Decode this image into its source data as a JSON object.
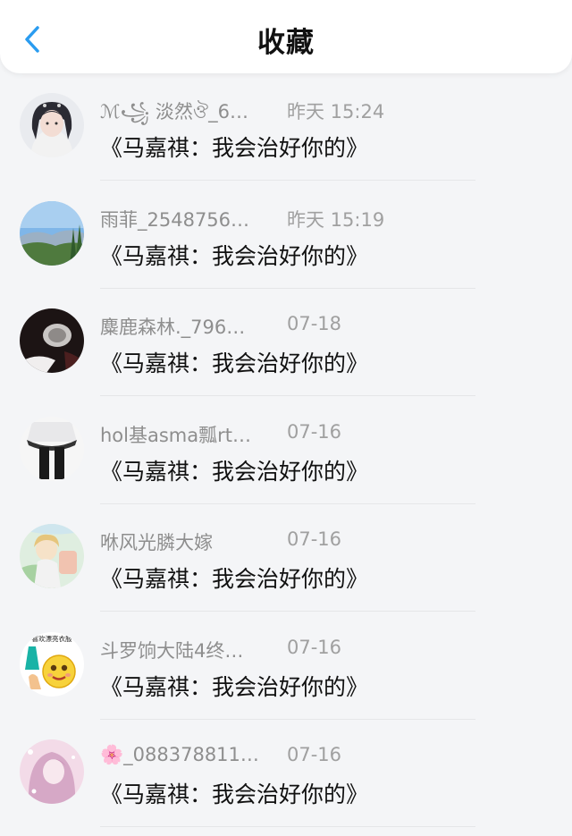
{
  "header": {
    "title": "收藏",
    "back_icon": "chevron-left-icon",
    "accent": "#2a9cf0"
  },
  "items": [
    {
      "name": "ℳ꧁ 淡然ঔ_6…",
      "time": "昨天 15:24",
      "message": "《马嘉祺：我会治好你的》",
      "avatar": "anime-girl-avatar"
    },
    {
      "name": "雨菲_2548756…",
      "time": "昨天 15:19",
      "message": "《马嘉祺：我会治好你的》",
      "avatar": "landscape-avatar"
    },
    {
      "name": "麋鹿森林._796…",
      "time": "07-18",
      "message": "《马嘉祺：我会治好你的》",
      "avatar": "dark-photo-avatar"
    },
    {
      "name": "hol基asma瓢rt…",
      "time": "07-16",
      "message": "《马嘉祺：我会治好你的》",
      "avatar": "skirt-legs-avatar"
    },
    {
      "name": "咻风光膦大嫁",
      "time": "07-16",
      "message": "《马嘉祺：我会治好你的》",
      "avatar": "anime-boy-avatar"
    },
    {
      "name": "斗罗饷大陆4终…",
      "time": "07-16",
      "message": "《马嘉祺：我会治好你的》",
      "avatar": "emoji-avatar",
      "avatar_text": "喜欢漂亮衣服"
    },
    {
      "name": "🌸_088378811…",
      "time": "07-16",
      "message": "《马嘉祺：我会治好你的》",
      "avatar": "pink-anime-girl-avatar"
    }
  ]
}
